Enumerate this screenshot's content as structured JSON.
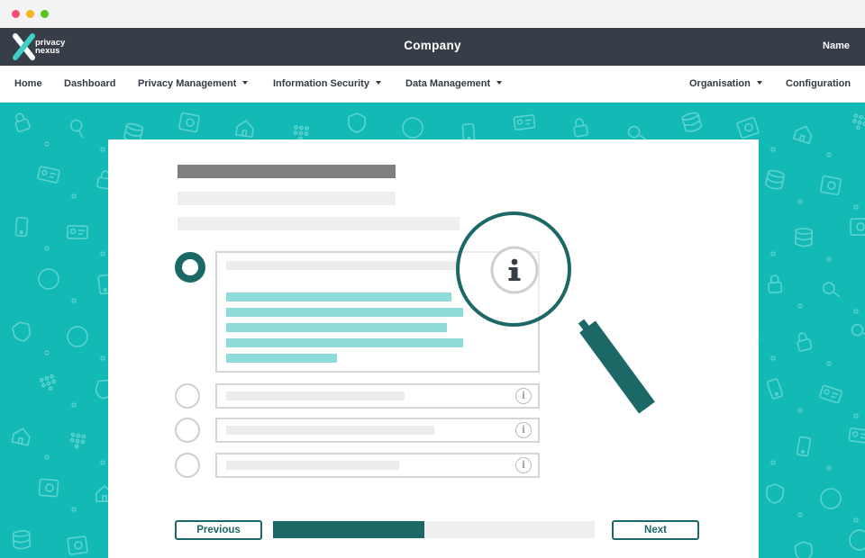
{
  "window": {
    "controls": [
      {
        "name": "close",
        "color": "#fa4f73"
      },
      {
        "name": "minimize",
        "color": "#f7b51b"
      },
      {
        "name": "maximize",
        "color": "#57c31e"
      }
    ]
  },
  "header": {
    "logo_line1": "privacy",
    "logo_line2": "nexus",
    "company": "Company",
    "user_name": "Name"
  },
  "nav": {
    "left": [
      {
        "label": "Home",
        "dropdown": false
      },
      {
        "label": "Dashboard",
        "dropdown": false
      },
      {
        "label": "Privacy Management",
        "dropdown": true
      },
      {
        "label": "Information Security",
        "dropdown": true
      },
      {
        "label": "Data Management",
        "dropdown": true
      }
    ],
    "right": [
      {
        "label": "Organisation",
        "dropdown": true
      },
      {
        "label": "Configuration",
        "dropdown": false
      }
    ]
  },
  "wizard": {
    "options_count": 4,
    "selected_option": 1,
    "info_icon": "info-icon",
    "previous_label": "Previous",
    "next_label": "Next",
    "progress_fraction": 0.47
  },
  "colors": {
    "header_bg": "#383e47",
    "background_teal": "#13b9b5",
    "accent_dark_teal": "#1c6866",
    "highlight_teal": "#8fdbd9",
    "logo_accent": "#3fcfc9"
  }
}
